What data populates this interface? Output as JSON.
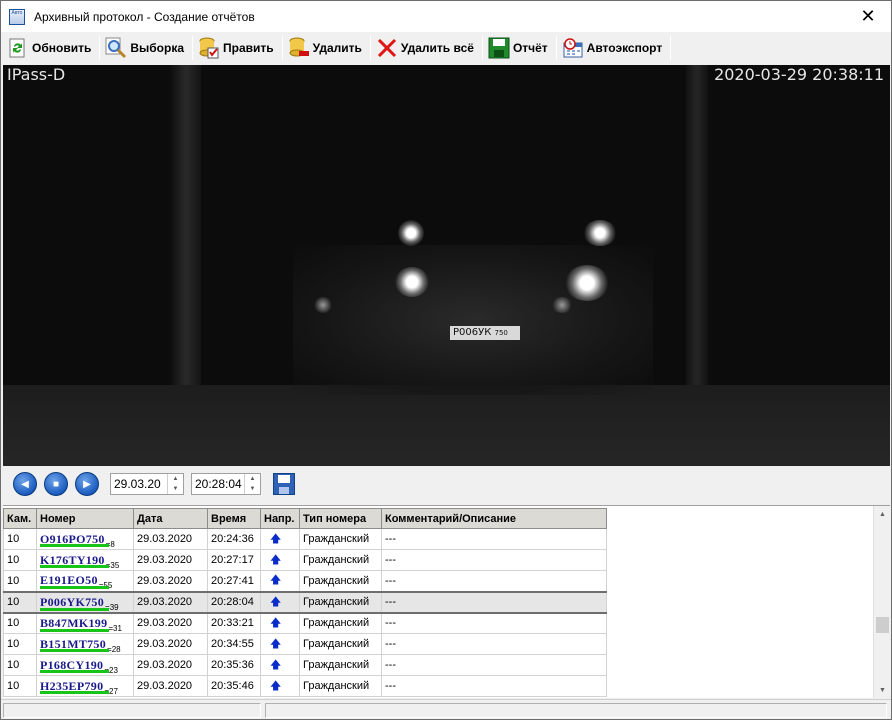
{
  "window": {
    "title": "Архивный протокол - Создание отчётов",
    "app_icon_text": "Авто"
  },
  "toolbar": {
    "refresh": "Обновить",
    "select": "Выборка",
    "edit": "Править",
    "delete": "Удалить",
    "delete_all": "Удалить всё",
    "report": "Отчёт",
    "autoexport": "Автоэкспорт"
  },
  "video": {
    "camera_label": "IPass-D",
    "timestamp": "2020-03-29 20:38:11",
    "plate_text": "P006УК",
    "plate_region": "750"
  },
  "navigation": {
    "date_value": "29.03.20",
    "time_value": "20:28:04"
  },
  "table": {
    "columns": [
      "Кам.",
      "Номер",
      "Дата",
      "Время",
      "Напр.",
      "Тип номера",
      "Комментарий/Описание"
    ],
    "rows": [
      {
        "cam": "10",
        "plate": "O916PO750",
        "conf": "=8",
        "date": "29.03.2020",
        "time": "20:24:36",
        "type": "Гражданский",
        "comment": "---"
      },
      {
        "cam": "10",
        "plate": "K176TY190",
        "conf": "=35",
        "date": "29.03.2020",
        "time": "20:27:17",
        "type": "Гражданский",
        "comment": "---"
      },
      {
        "cam": "10",
        "plate": "E191EO50",
        "conf": "=55",
        "date": "29.03.2020",
        "time": "20:27:41",
        "type": "Гражданский",
        "comment": "---"
      },
      {
        "cam": "10",
        "plate": "P006YK750",
        "conf": "=39",
        "date": "29.03.2020",
        "time": "20:28:04",
        "type": "Гражданский",
        "comment": "---"
      },
      {
        "cam": "10",
        "plate": "B847MK199",
        "conf": "=31",
        "date": "29.03.2020",
        "time": "20:33:21",
        "type": "Гражданский",
        "comment": "---"
      },
      {
        "cam": "10",
        "plate": "B151MT750",
        "conf": "=28",
        "date": "29.03.2020",
        "time": "20:34:55",
        "type": "Гражданский",
        "comment": "---"
      },
      {
        "cam": "10",
        "plate": "P168CY190",
        "conf": "=23",
        "date": "29.03.2020",
        "time": "20:35:36",
        "type": "Гражданский",
        "comment": "---"
      },
      {
        "cam": "10",
        "plate": "H235EP790",
        "conf": "=27",
        "date": "29.03.2020",
        "time": "20:35:46",
        "type": "Гражданский",
        "comment": "---"
      }
    ],
    "direction_icon": "up-arrow-icon",
    "selected_row": 3
  },
  "colors": {
    "accent_blue": "#1a5cc0",
    "plate_text": "#1a1a8c",
    "confidence_bar": "#18c418",
    "direction_arrow": "#0a2cc8"
  }
}
